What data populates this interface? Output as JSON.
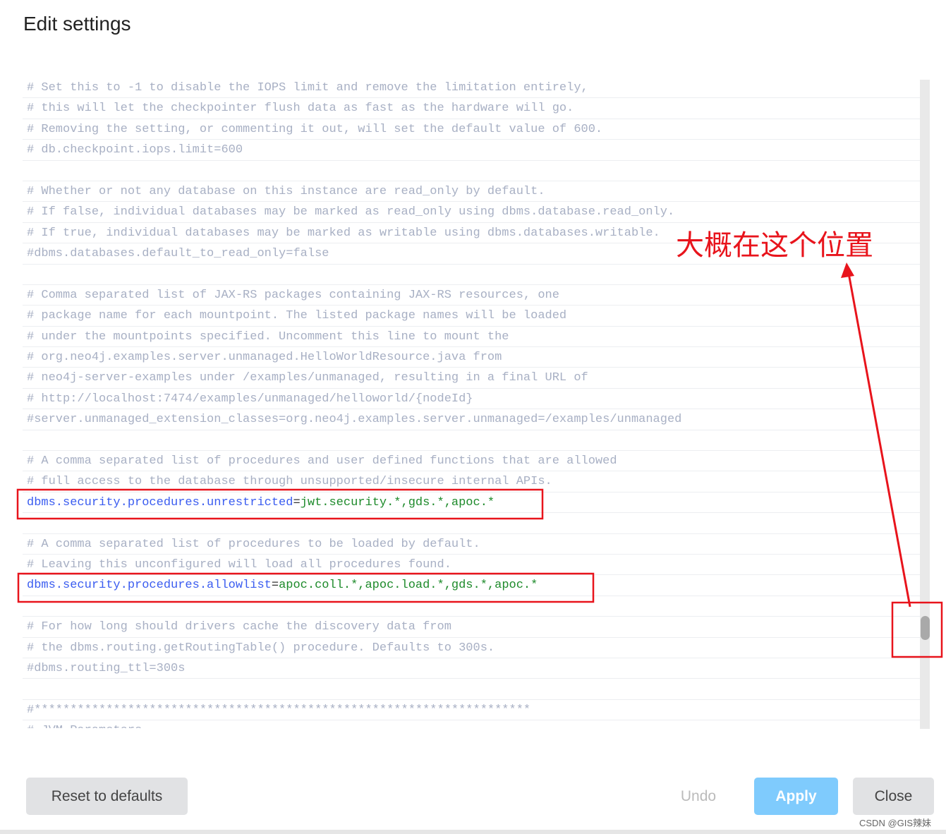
{
  "dialog": {
    "title": "Edit settings"
  },
  "editor": {
    "lines": [
      {
        "type": "comment",
        "text": "# Set this to -1 to disable the IOPS limit and remove the limitation entirely,"
      },
      {
        "type": "comment",
        "text": "# this will let the checkpointer flush data as fast as the hardware will go."
      },
      {
        "type": "comment",
        "text": "# Removing the setting, or commenting it out, will set the default value of 600."
      },
      {
        "type": "comment",
        "text": "# db.checkpoint.iops.limit=600"
      },
      {
        "type": "blank",
        "text": ""
      },
      {
        "type": "comment",
        "text": "# Whether or not any database on this instance are read_only by default."
      },
      {
        "type": "comment",
        "text": "# If false, individual databases may be marked as read_only using dbms.database.read_only."
      },
      {
        "type": "comment",
        "text": "# If true, individual databases may be marked as writable using dbms.databases.writable."
      },
      {
        "type": "comment",
        "text": "#dbms.databases.default_to_read_only=false"
      },
      {
        "type": "blank",
        "text": ""
      },
      {
        "type": "comment",
        "text": "# Comma separated list of JAX-RS packages containing JAX-RS resources, one"
      },
      {
        "type": "comment",
        "text": "# package name for each mountpoint. The listed package names will be loaded"
      },
      {
        "type": "comment",
        "text": "# under the mountpoints specified. Uncomment this line to mount the"
      },
      {
        "type": "comment",
        "text": "# org.neo4j.examples.server.unmanaged.HelloWorldResource.java from"
      },
      {
        "type": "comment",
        "text": "# neo4j-server-examples under /examples/unmanaged, resulting in a final URL of"
      },
      {
        "type": "comment",
        "text": "# http://localhost:7474/examples/unmanaged/helloworld/{nodeId}"
      },
      {
        "type": "comment",
        "text": "#server.unmanaged_extension_classes=org.neo4j.examples.server.unmanaged=/examples/unmanaged"
      },
      {
        "type": "blank",
        "text": ""
      },
      {
        "type": "comment",
        "text": "# A comma separated list of procedures and user defined functions that are allowed"
      },
      {
        "type": "comment",
        "text": "# full access to the database through unsupported/insecure internal APIs."
      },
      {
        "type": "setting",
        "key": "dbms.security.procedures.unrestricted",
        "value": "jwt.security.*,gds.*,apoc.*"
      },
      {
        "type": "blank",
        "text": ""
      },
      {
        "type": "comment",
        "text": "# A comma separated list of procedures to be loaded by default."
      },
      {
        "type": "comment",
        "text": "# Leaving this unconfigured will load all procedures found."
      },
      {
        "type": "setting",
        "key": "dbms.security.procedures.allowlist",
        "value": "apoc.coll.*,apoc.load.*,gds.*,apoc.*"
      },
      {
        "type": "blank",
        "text": ""
      },
      {
        "type": "comment",
        "text": "# For how long should drivers cache the discovery data from"
      },
      {
        "type": "comment",
        "text": "# the dbms.routing.getRoutingTable() procedure. Defaults to 300s."
      },
      {
        "type": "comment",
        "text": "#dbms.routing_ttl=300s"
      },
      {
        "type": "blank",
        "text": ""
      },
      {
        "type": "comment",
        "text": "#*********************************************************************"
      },
      {
        "type": "comment",
        "text": "# JVM Parameters"
      }
    ]
  },
  "buttons": {
    "reset": "Reset to defaults",
    "undo": "Undo",
    "apply": "Apply",
    "close": "Close"
  },
  "annotation": {
    "text": "大概在这个位置",
    "color": "#e8141c"
  },
  "watermark": "CSDN @GIS辣妹",
  "colors": {
    "apply_bg": "#7fcbfd",
    "setting_key": "#3a5cf0",
    "setting_value": "#1d8a2a",
    "comment": "#a8b0c4"
  }
}
